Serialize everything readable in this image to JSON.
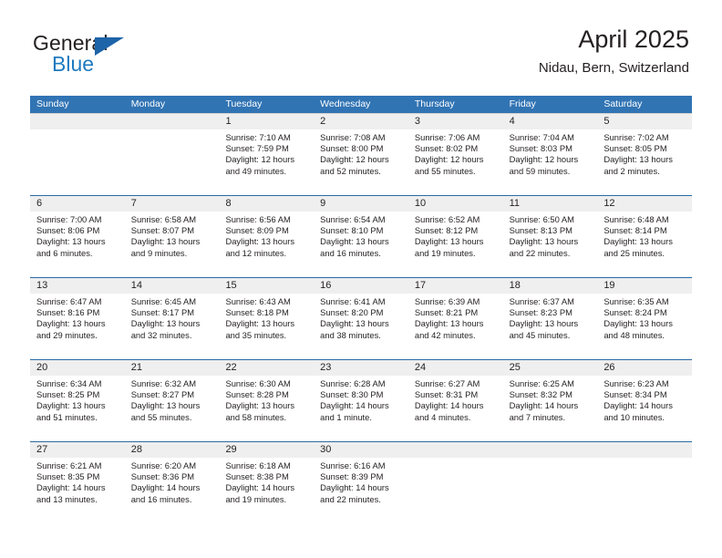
{
  "brand": {
    "name_top": "General",
    "name_bottom": "Blue",
    "accent_color": "#1d64a8",
    "blue_text_color": "#1f7ac0"
  },
  "header": {
    "title": "April 2025",
    "subtitle": "Nidau, Bern, Switzerland"
  },
  "calendar": {
    "header_bg": "#3174b4",
    "numband_bg": "#efefef",
    "weekdays": [
      "Sunday",
      "Monday",
      "Tuesday",
      "Wednesday",
      "Thursday",
      "Friday",
      "Saturday"
    ],
    "weeks": [
      {
        "accent": false,
        "days": [
          {
            "num": "",
            "lines": []
          },
          {
            "num": "",
            "lines": []
          },
          {
            "num": "1",
            "lines": [
              "Sunrise: 7:10 AM",
              "Sunset: 7:59 PM",
              "Daylight: 12 hours",
              "and 49 minutes."
            ]
          },
          {
            "num": "2",
            "lines": [
              "Sunrise: 7:08 AM",
              "Sunset: 8:00 PM",
              "Daylight: 12 hours",
              "and 52 minutes."
            ]
          },
          {
            "num": "3",
            "lines": [
              "Sunrise: 7:06 AM",
              "Sunset: 8:02 PM",
              "Daylight: 12 hours",
              "and 55 minutes."
            ]
          },
          {
            "num": "4",
            "lines": [
              "Sunrise: 7:04 AM",
              "Sunset: 8:03 PM",
              "Daylight: 12 hours",
              "and 59 minutes."
            ]
          },
          {
            "num": "5",
            "lines": [
              "Sunrise: 7:02 AM",
              "Sunset: 8:05 PM",
              "Daylight: 13 hours",
              "and 2 minutes."
            ]
          }
        ]
      },
      {
        "accent": true,
        "days": [
          {
            "num": "6",
            "lines": [
              "Sunrise: 7:00 AM",
              "Sunset: 8:06 PM",
              "Daylight: 13 hours",
              "and 6 minutes."
            ]
          },
          {
            "num": "7",
            "lines": [
              "Sunrise: 6:58 AM",
              "Sunset: 8:07 PM",
              "Daylight: 13 hours",
              "and 9 minutes."
            ]
          },
          {
            "num": "8",
            "lines": [
              "Sunrise: 6:56 AM",
              "Sunset: 8:09 PM",
              "Daylight: 13 hours",
              "and 12 minutes."
            ]
          },
          {
            "num": "9",
            "lines": [
              "Sunrise: 6:54 AM",
              "Sunset: 8:10 PM",
              "Daylight: 13 hours",
              "and 16 minutes."
            ]
          },
          {
            "num": "10",
            "lines": [
              "Sunrise: 6:52 AM",
              "Sunset: 8:12 PM",
              "Daylight: 13 hours",
              "and 19 minutes."
            ]
          },
          {
            "num": "11",
            "lines": [
              "Sunrise: 6:50 AM",
              "Sunset: 8:13 PM",
              "Daylight: 13 hours",
              "and 22 minutes."
            ]
          },
          {
            "num": "12",
            "lines": [
              "Sunrise: 6:48 AM",
              "Sunset: 8:14 PM",
              "Daylight: 13 hours",
              "and 25 minutes."
            ]
          }
        ]
      },
      {
        "accent": true,
        "days": [
          {
            "num": "13",
            "lines": [
              "Sunrise: 6:47 AM",
              "Sunset: 8:16 PM",
              "Daylight: 13 hours",
              "and 29 minutes."
            ]
          },
          {
            "num": "14",
            "lines": [
              "Sunrise: 6:45 AM",
              "Sunset: 8:17 PM",
              "Daylight: 13 hours",
              "and 32 minutes."
            ]
          },
          {
            "num": "15",
            "lines": [
              "Sunrise: 6:43 AM",
              "Sunset: 8:18 PM",
              "Daylight: 13 hours",
              "and 35 minutes."
            ]
          },
          {
            "num": "16",
            "lines": [
              "Sunrise: 6:41 AM",
              "Sunset: 8:20 PM",
              "Daylight: 13 hours",
              "and 38 minutes."
            ]
          },
          {
            "num": "17",
            "lines": [
              "Sunrise: 6:39 AM",
              "Sunset: 8:21 PM",
              "Daylight: 13 hours",
              "and 42 minutes."
            ]
          },
          {
            "num": "18",
            "lines": [
              "Sunrise: 6:37 AM",
              "Sunset: 8:23 PM",
              "Daylight: 13 hours",
              "and 45 minutes."
            ]
          },
          {
            "num": "19",
            "lines": [
              "Sunrise: 6:35 AM",
              "Sunset: 8:24 PM",
              "Daylight: 13 hours",
              "and 48 minutes."
            ]
          }
        ]
      },
      {
        "accent": true,
        "days": [
          {
            "num": "20",
            "lines": [
              "Sunrise: 6:34 AM",
              "Sunset: 8:25 PM",
              "Daylight: 13 hours",
              "and 51 minutes."
            ]
          },
          {
            "num": "21",
            "lines": [
              "Sunrise: 6:32 AM",
              "Sunset: 8:27 PM",
              "Daylight: 13 hours",
              "and 55 minutes."
            ]
          },
          {
            "num": "22",
            "lines": [
              "Sunrise: 6:30 AM",
              "Sunset: 8:28 PM",
              "Daylight: 13 hours",
              "and 58 minutes."
            ]
          },
          {
            "num": "23",
            "lines": [
              "Sunrise: 6:28 AM",
              "Sunset: 8:30 PM",
              "Daylight: 14 hours",
              "and 1 minute."
            ]
          },
          {
            "num": "24",
            "lines": [
              "Sunrise: 6:27 AM",
              "Sunset: 8:31 PM",
              "Daylight: 14 hours",
              "and 4 minutes."
            ]
          },
          {
            "num": "25",
            "lines": [
              "Sunrise: 6:25 AM",
              "Sunset: 8:32 PM",
              "Daylight: 14 hours",
              "and 7 minutes."
            ]
          },
          {
            "num": "26",
            "lines": [
              "Sunrise: 6:23 AM",
              "Sunset: 8:34 PM",
              "Daylight: 14 hours",
              "and 10 minutes."
            ]
          }
        ]
      },
      {
        "accent": true,
        "days": [
          {
            "num": "27",
            "lines": [
              "Sunrise: 6:21 AM",
              "Sunset: 8:35 PM",
              "Daylight: 14 hours",
              "and 13 minutes."
            ]
          },
          {
            "num": "28",
            "lines": [
              "Sunrise: 6:20 AM",
              "Sunset: 8:36 PM",
              "Daylight: 14 hours",
              "and 16 minutes."
            ]
          },
          {
            "num": "29",
            "lines": [
              "Sunrise: 6:18 AM",
              "Sunset: 8:38 PM",
              "Daylight: 14 hours",
              "and 19 minutes."
            ]
          },
          {
            "num": "30",
            "lines": [
              "Sunrise: 6:16 AM",
              "Sunset: 8:39 PM",
              "Daylight: 14 hours",
              "and 22 minutes."
            ]
          },
          {
            "num": "",
            "lines": []
          },
          {
            "num": "",
            "lines": []
          },
          {
            "num": "",
            "lines": []
          }
        ]
      }
    ]
  }
}
